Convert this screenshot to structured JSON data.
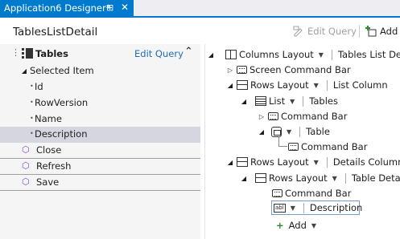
{
  "tab": {
    "title": "Application6 Designer*",
    "pin": "⊞",
    "close": "✕"
  },
  "header": {
    "title": "TablesListDetail"
  },
  "toolbar": {
    "edit_query": "Edit Query",
    "add": "Add"
  },
  "left": {
    "group_title": "Tables",
    "group_action": "Edit Query",
    "selected_item": "Selected Item",
    "fields": [
      "Id",
      "RowVersion",
      "Name",
      "Description"
    ],
    "methods": [
      "Close",
      "Refresh",
      "Save"
    ]
  },
  "tree": {
    "columns_layout": "Columns Layout",
    "columns_value": "Tables List Detail",
    "screen_command_bar": "Screen Command Bar",
    "rows_layout_1": "Rows Layout",
    "list_column": "List Column",
    "list": "List",
    "list_value": "Tables",
    "command_bar_1": "Command Bar",
    "table": "Table",
    "command_bar_2": "Command Bar",
    "rows_layout_2": "Rows Layout",
    "details_column": "Details Column",
    "rows_layout_3": "Rows Layout",
    "table_details": "Table Details",
    "command_bar_3": "Command Bar",
    "description_field": "Description",
    "add": "Add"
  },
  "colors": {
    "accent": "#007acc",
    "selection": "#d6d6e0",
    "method": "#7e4bb5",
    "link": "#1e6bb8"
  }
}
